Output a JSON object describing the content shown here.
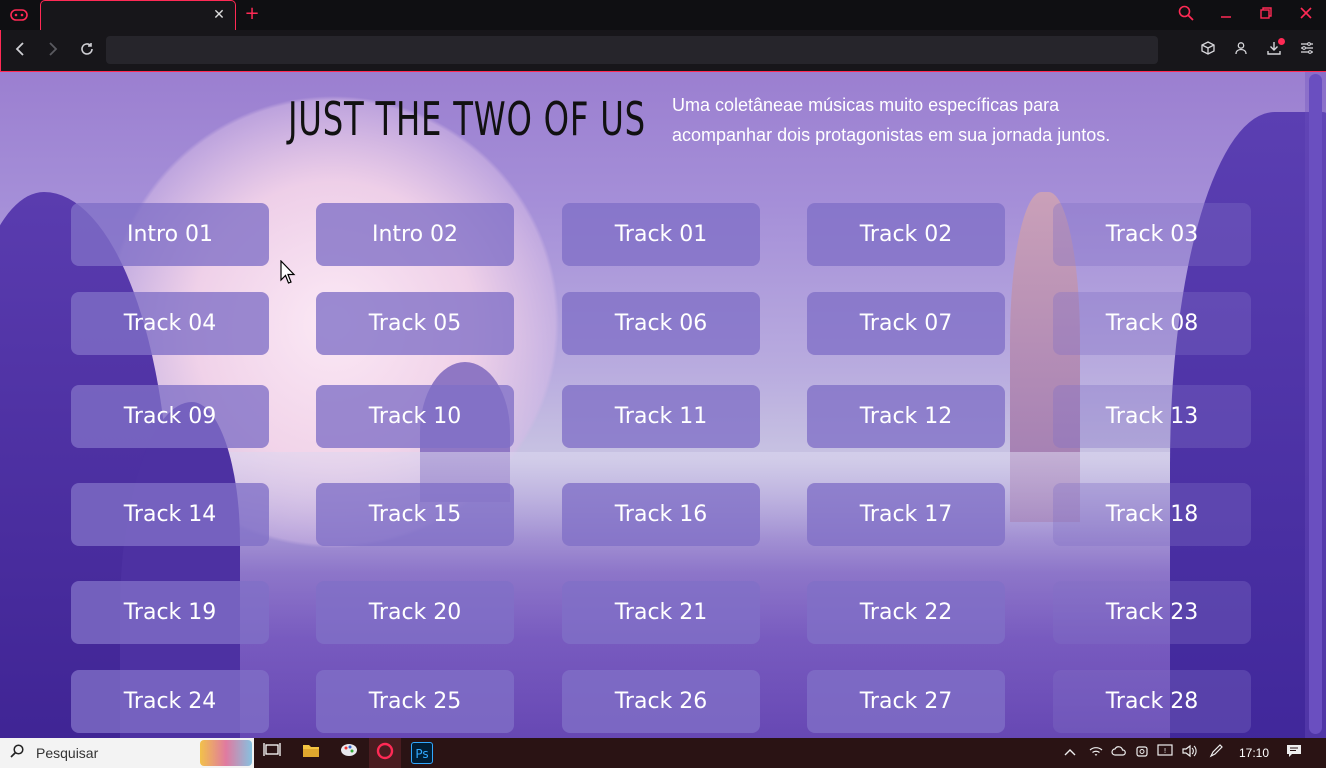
{
  "browser": {
    "address": "",
    "tab_close": "✕",
    "new_tab": "+"
  },
  "page": {
    "title": "Just the two of us",
    "subtitle_line1": "Uma coletâneae músicas muito específicas para",
    "subtitle_line2": "acompanhar dois protagonistas em sua jornada juntos.",
    "tracks": [
      "Intro 01",
      "Intro 02",
      "Track 01",
      "Track 02",
      "Track 03",
      "Track 04",
      "Track 05",
      "Track 06",
      "Track 07",
      "Track 08",
      "Track 09",
      "Track 10",
      "Track 11",
      "Track 12",
      "Track 13",
      "Track 14",
      "Track 15",
      "Track 16",
      "Track 17",
      "Track 18",
      "Track 19",
      "Track 20",
      "Track 21",
      "Track 22",
      "Track 23",
      "Track 24",
      "Track 25",
      "Track 26",
      "Track 27",
      "Track 28"
    ]
  },
  "taskbar": {
    "search_placeholder": "Pesquisar",
    "clock": "17:10",
    "apps": [
      "task-view",
      "file-explorer",
      "paint",
      "opera-gx",
      "photoshop"
    ],
    "photoshop_label": "Ps"
  },
  "colors": {
    "accent": "#ff2a55",
    "button_bg": "#8070c6",
    "sky_top": "#9b7fd0",
    "rock": "#4b2fa0"
  }
}
